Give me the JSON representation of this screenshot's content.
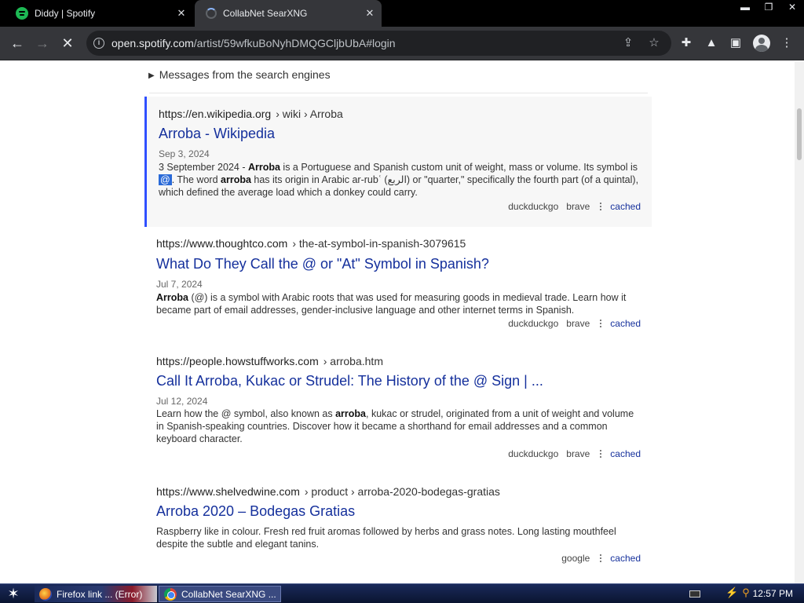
{
  "browser": {
    "tabs": [
      {
        "title": "Diddy | Spotify",
        "icon": "spotify-icon"
      },
      {
        "title": "CollabNet SearXNG",
        "icon": "loading-icon"
      }
    ],
    "url_host": "open.spotify.com",
    "url_path": "/artist/59wfkuBoNyhDMQGCljbUbA#login"
  },
  "page": {
    "engines_message": "Messages from the search engines",
    "results": [
      {
        "url": "https://en.wikipedia.org",
        "crumbs": "› wiki › Arroba",
        "title": "Arroba - Wikipedia",
        "date": "Sep 3, 2024",
        "snippet_parts": {
          "a": "3 September 2024 - ",
          "b": "Arroba",
          "c": " is a Portuguese and Spanish custom unit of weight, mass or volume. Its symbol is ",
          "d": "@",
          "e": ". The word ",
          "f": "arroba",
          "g": " has its origin in Arabic ar-rubʿ (الربع) or \"quarter,\" specifically the fourth part (of a quintal), which defined the average load which a donkey could carry."
        },
        "engines": [
          "duckduckgo",
          "brave"
        ],
        "cached": "cached"
      },
      {
        "url": "https://www.thoughtco.com",
        "crumbs": "› the-at-symbol-in-spanish-3079615",
        "title": "What Do They Call the @ or \"At\" Symbol in Spanish?",
        "date": "Jul 7, 2024",
        "snippet_parts": {
          "a": "",
          "b": "Arroba",
          "c": " (@) is a symbol with Arabic roots that was used for measuring goods in medieval trade. Learn how it became part of email addresses, gender-inclusive language and other internet terms in Spanish."
        },
        "engines": [
          "duckduckgo",
          "brave"
        ],
        "cached": "cached"
      },
      {
        "url": "https://people.howstuffworks.com",
        "crumbs": "› arroba.htm",
        "title": "Call It Arroba, Kukac or Strudel: The History of the @ Sign | ...",
        "date": "Jul 12, 2024",
        "snippet_parts": {
          "a": "Learn how the @ symbol, also known as ",
          "b": "arroba",
          "c": ", kukac or strudel, originated from a unit of weight and volume in Spanish-speaking countries. Discover how it became a shorthand for email addresses and a common keyboard character."
        },
        "engines": [
          "duckduckgo",
          "brave"
        ],
        "cached": "cached"
      },
      {
        "url": "https://www.shelvedwine.com",
        "crumbs": "› product › arroba-2020-bodegas-gratias",
        "title": "Arroba 2020 – Bodegas Gratias",
        "snippet_parts": {
          "a": "Raspberry like in colour. Fresh red fruit aromas followed by herbs and grass notes. Long lasting mouthfeel despite the subtle and elegant tanins."
        },
        "engines": [
          "google"
        ],
        "cached": "cached"
      }
    ]
  },
  "taskbar": {
    "tasks": [
      {
        "title": "Firefox link ... (Error)"
      },
      {
        "title": "CollabNet SearXNG ..."
      }
    ],
    "clock": "12:57 PM"
  }
}
